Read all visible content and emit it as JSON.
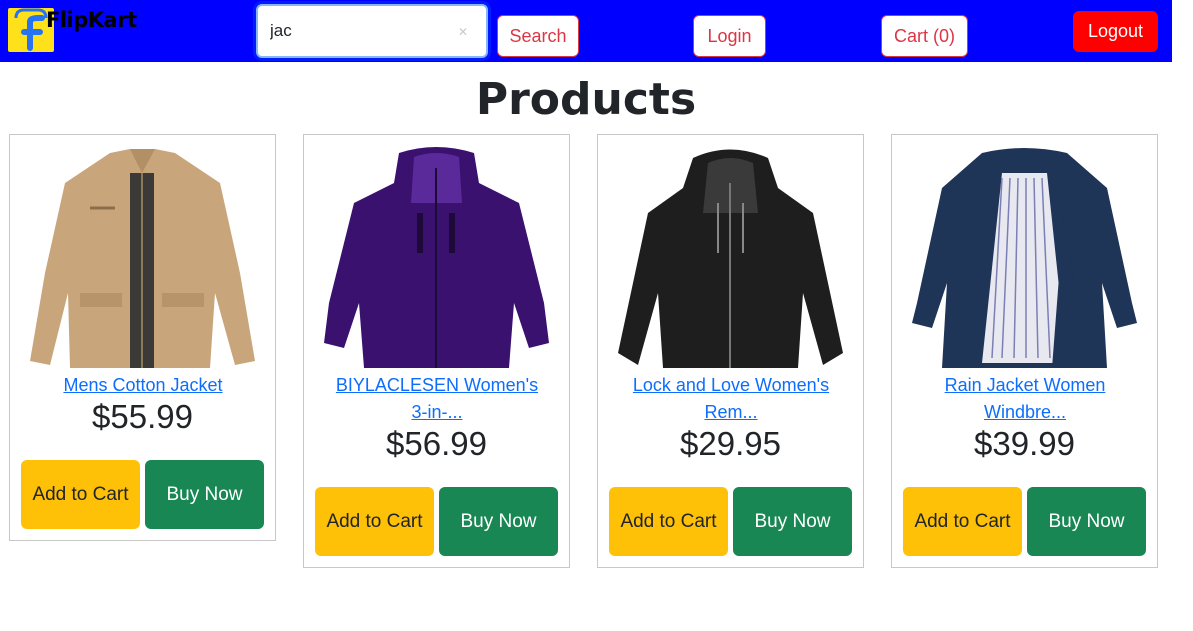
{
  "brand": {
    "name": "FlipKart",
    "logo_icon": "shopping-bag-f-logo-icon",
    "logo_color": "#ffe11b"
  },
  "search": {
    "value": "jac",
    "button_label": "Search"
  },
  "nav": {
    "login_label": "Login",
    "cart_label": "Cart (0)",
    "logout_label": "Logout"
  },
  "colors": {
    "navbar": "#0000ff",
    "link": "#0d6efd",
    "add_to_cart": "#ffc107",
    "buy_now": "#198754",
    "logout": "#ff0000"
  },
  "page_title": "Products",
  "products": [
    {
      "title": "Mens Cotton Jacket",
      "price": "$55.99",
      "add_label": "Add to Cart",
      "buy_label": "Buy Now",
      "image": "beige-cotton-jacket-image"
    },
    {
      "title": "BIYLACLESEN Women's 3-in-...",
      "price": "$56.99",
      "add_label": "Add to Cart",
      "buy_label": "Buy Now",
      "image": "purple-hooded-jacket-image"
    },
    {
      "title": "Lock and Love Women's Rem...",
      "price": "$29.95",
      "add_label": "Add to Cart",
      "buy_label": "Buy Now",
      "image": "black-leather-jacket-image"
    },
    {
      "title": "Rain Jacket Women Windbre...",
      "price": "$39.99",
      "add_label": "Add to Cart",
      "buy_label": "Buy Now",
      "image": "navy-rain-jacket-image"
    }
  ]
}
